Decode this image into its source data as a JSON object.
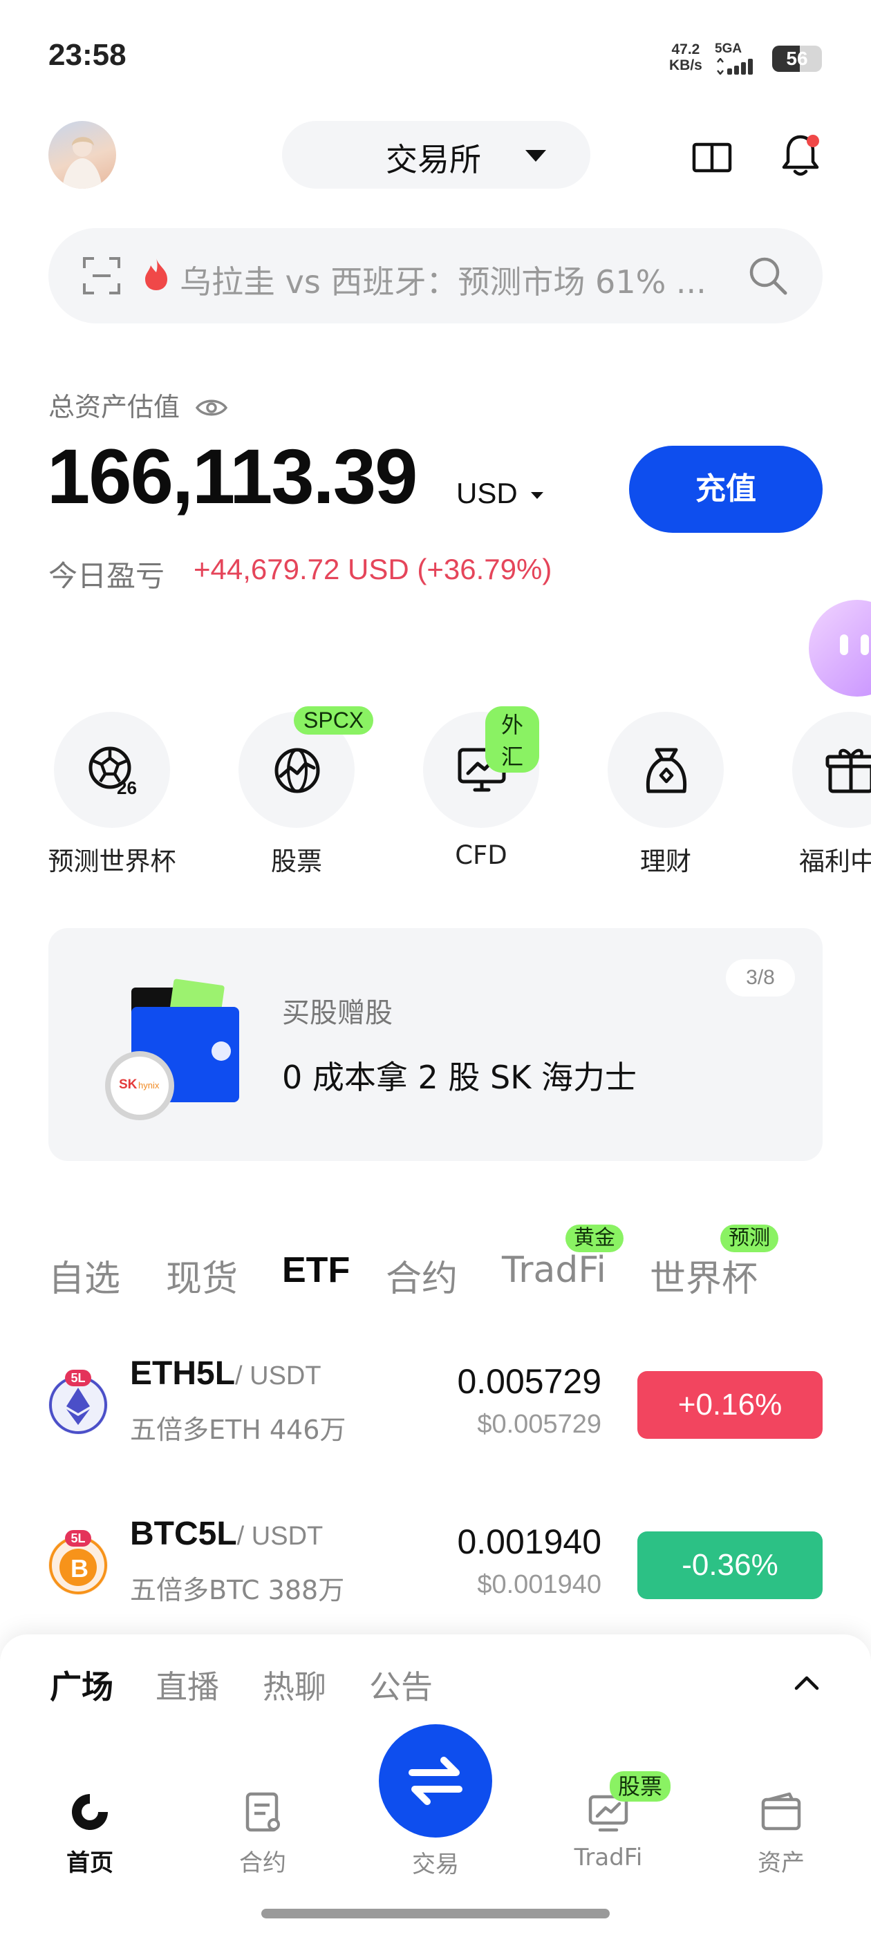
{
  "status_bar": {
    "time": "23:58",
    "net_speed_value": "47.2",
    "net_speed_unit": "KB/s",
    "signal": "5GA",
    "battery": "56"
  },
  "header": {
    "switcher_label": "交易所"
  },
  "search": {
    "text": "乌拉圭 vs 西班牙：预测市场 61% ..."
  },
  "assets": {
    "label": "总资产估值",
    "value": "166,113.39",
    "currency": "USD",
    "deposit_label": "充值",
    "pnl_label": "今日盈亏",
    "pnl_value": "+44,679.72 USD (+36.79%)"
  },
  "shortcuts": [
    {
      "label": "预测世界杯",
      "icon": "soccer-ball-26-icon",
      "badge": ""
    },
    {
      "label": "股票",
      "icon": "globe-chart-icon",
      "badge": "SPCX"
    },
    {
      "label": "CFD",
      "icon": "monitor-chart-icon",
      "badge": "外汇"
    },
    {
      "label": "理财",
      "icon": "money-bag-icon",
      "badge": ""
    },
    {
      "label": "福利中",
      "icon": "gift-icon",
      "badge": ""
    }
  ],
  "promo": {
    "subtitle": "买股赠股",
    "title": "0 成本拿 2 股 SK 海力士",
    "page": "3/8",
    "logo_text": "SK hynix"
  },
  "market_tabs": [
    {
      "label": "自选",
      "badge": ""
    },
    {
      "label": "现货",
      "badge": ""
    },
    {
      "label": "ETF",
      "badge": ""
    },
    {
      "label": "合约",
      "badge": ""
    },
    {
      "label": "TradFi",
      "badge": "黄金"
    },
    {
      "label": "世界杯",
      "badge": "预测"
    }
  ],
  "market_rows": [
    {
      "symbol": "ETH5L",
      "quote": "/ USDT",
      "desc": "五倍多ETH 446万",
      "price": "0.005729",
      "fiat": "$0.005729",
      "change": "+0.16%",
      "change_color": "#f2455f",
      "coin_badge": "5L"
    },
    {
      "symbol": "BTC5L",
      "quote": "/ USDT",
      "desc": "五倍多BTC 388万",
      "price": "0.001940",
      "fiat": "$0.001940",
      "change": "-0.36%",
      "change_color": "#2cc185",
      "coin_badge": "5L"
    }
  ],
  "bottom_panel": {
    "tabs": [
      "广场",
      "直播",
      "热聊",
      "公告"
    ]
  },
  "nav": [
    {
      "label": "首页",
      "icon": "home-icon"
    },
    {
      "label": "合约",
      "icon": "contract-icon"
    },
    {
      "label": "交易",
      "icon": "swap-icon"
    },
    {
      "label": "TradFi",
      "icon": "tradfi-icon",
      "badge": "股票"
    },
    {
      "label": "资产",
      "icon": "wallet-icon"
    }
  ],
  "colors": {
    "brand_blue": "#0e4eee",
    "up_red": "#f2455f",
    "down_green": "#2cc185",
    "badge_green": "#8af263",
    "pnl_red": "#e5455a"
  }
}
